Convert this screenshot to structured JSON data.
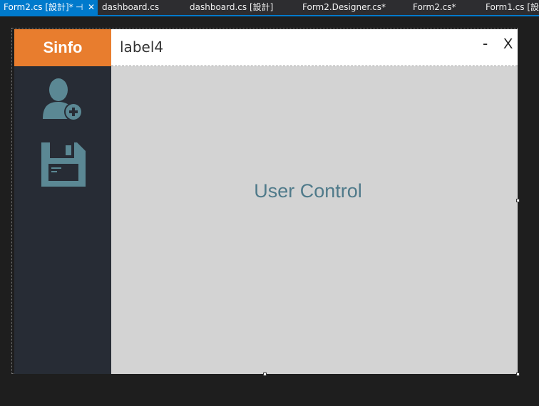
{
  "tabs": [
    {
      "label": "Form2.cs [設計]*",
      "active": true
    },
    {
      "label": "dashboard.cs",
      "active": false
    },
    {
      "label": "dashboard.cs [設計]",
      "active": false
    },
    {
      "label": "Form2.Designer.cs*",
      "active": false
    },
    {
      "label": "Form2.cs*",
      "active": false
    },
    {
      "label": "Form1.cs [設計",
      "active": false
    }
  ],
  "tab_pin_glyph": "⊣",
  "tab_close_glyph": "✕",
  "form": {
    "logo_text": "Sinfo",
    "header_title": "label4",
    "minimize_label": "-",
    "close_label": "X",
    "content_label": "User Control",
    "sidebar_icons": [
      "add-user-icon",
      "save-icon"
    ]
  },
  "colors": {
    "accent_orange": "#e87d2e",
    "sidebar": "#272c35",
    "icon": "#5b8894",
    "content_bg": "#d3d3d3",
    "content_text": "#4f7a8a",
    "tab_active": "#007acc"
  }
}
